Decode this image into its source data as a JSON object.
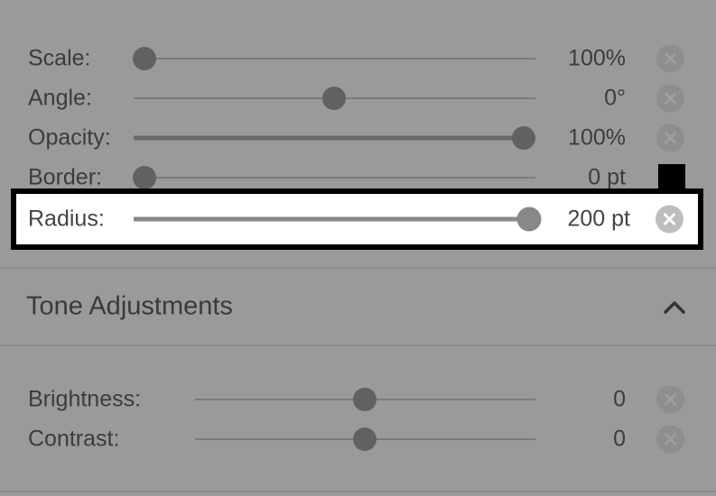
{
  "layout_rows": [
    {
      "label": "Scale:",
      "value": "100%",
      "level": 0
    },
    {
      "label": "Angle:",
      "value": "0°",
      "level": 0.5
    },
    {
      "label": "Opacity:",
      "value": "100%",
      "level": 1
    },
    {
      "label": "Border:",
      "value": "0 pt",
      "level": 0
    }
  ],
  "radius": {
    "label": "Radius:",
    "value": "200 pt",
    "level": 1
  },
  "border_color": "#000000",
  "tone": {
    "title": "Tone Adjustments",
    "rows": [
      {
        "label": "Brightness:",
        "value": "0",
        "level": 0.5
      },
      {
        "label": "Contrast:",
        "value": "0",
        "level": 0.5
      }
    ]
  },
  "icons": {
    "reset": "close-circle-icon",
    "collapse": "chevron-up-icon"
  }
}
